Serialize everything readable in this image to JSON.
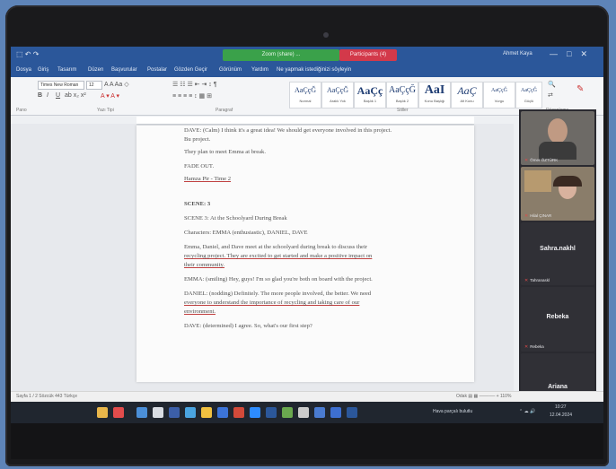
{
  "window": {
    "notification_green": "Zoom (share) ... ",
    "notification_red": "Participants (4)",
    "user": "Ahmet Kaya",
    "controls": [
      "—",
      "□",
      "✕"
    ]
  },
  "menu": [
    "Dosya",
    "Giriş",
    "Tasarım",
    "Düzen",
    "Başvurular",
    "Postalar",
    "Gözden Geçir",
    "Görünüm",
    "Yardım",
    "Ne yapmak istediğinizi söyleyin"
  ],
  "ribbon": {
    "font_name": "Times New Roman",
    "font_size": "12",
    "styles": [
      {
        "sample": "AaÇçĞ",
        "name": "Normal"
      },
      {
        "sample": "AaÇçĞ",
        "name": "Aralık Yok"
      },
      {
        "sample": "AaÇç",
        "name": "Başlık 1"
      },
      {
        "sample": "AaÇçĞ",
        "name": "Başlık 2"
      },
      {
        "sample": "AaI",
        "name": "Konu Başlığı"
      },
      {
        "sample": "AaÇ",
        "name": "Alt Konu"
      },
      {
        "sample": "AaÇçĞ",
        "name": "Vurgu"
      },
      {
        "sample": "AaÇçĞ",
        "name": "Güçlü"
      }
    ],
    "groups": [
      "Pano",
      "Yazı Tipi",
      "Paragraf",
      "Stiller",
      "Düzenleme"
    ]
  },
  "document": {
    "lines": [
      "DAVE: (Calm) I think it's a great idea! We should get everyone involved in this project.",
      "Bu project.",
      "They plan to meet Emma at break.",
      "FADE OUT.",
      "Hamza Pir - Time 2",
      "SCENE: 3",
      "SCENE 3: At the Schoolyard During Break",
      "Characters: EMMA (enthusiastic), DANIEL, DAVE",
      "Emma, Daniel, and Dave meet at the schoolyard during break to discuss their",
      "recycling project. They are excited to get started and make a positive impact on",
      "their community.",
      "EMMA: (smiling) Hey, guys! I'm so glad you're both on board with the project.",
      "DANIEL: (nodding) Definitely. The more people involved, the better. We need",
      "everyone to understand the importance of recycling and taking care of our",
      "environment.",
      "DAVE: (determined) I agree. So, what's our first step?"
    ]
  },
  "participants": [
    {
      "name": "Ömer ÖZTÜRK",
      "type": "video"
    },
    {
      "name": "Hilal ÇINAR",
      "type": "video"
    },
    {
      "name": "Tahranaskl",
      "center": "Sahra.nakhl",
      "type": "name"
    },
    {
      "name": "Rebeka",
      "center": "Rebeka",
      "type": "name"
    },
    {
      "name": "Ariana",
      "center": "Ariana",
      "type": "name"
    }
  ],
  "statusbar": {
    "left": "Sayfa 1 / 2    Sözcük 443    Türkçe",
    "right": "Odak    ▤  ▦  ─────  +  110%"
  },
  "taskbar": {
    "tray_text": "Hava parçalı bulutlu",
    "time": "10:27",
    "date": "12.04.2024"
  }
}
